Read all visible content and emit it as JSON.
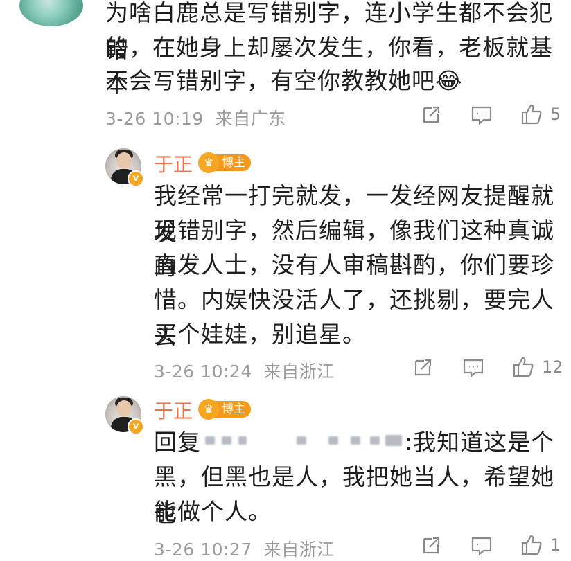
{
  "comment": {
    "lines": [
      "为啥白鹿总是写错别字，连小学生都不会犯错",
      "的，在她身上却屡次发生，你看，老板就基本",
      "不会写错别字，有空你教教她吧"
    ],
    "emoji": "😂",
    "time": "3-26 10:19",
    "location": "来自广东",
    "likes": "5"
  },
  "replies": [
    {
      "username": "于正",
      "badge": "博主",
      "lines": [
        "我经常一打完就发，一发经网友提醒就发",
        "现错别字，然后编辑，像我们这种真诚的",
        "直发人士，没有人审稿斟酌，你们要珍",
        "惜。内娱快没活人了，还挑剔，要完人去",
        "买个娃娃，别追星。"
      ],
      "time": "3-26 10:24",
      "location": "来自浙江",
      "likes": "12"
    },
    {
      "username": "于正",
      "badge": "博主",
      "reply_prefix": "回复",
      "lines_after_prefix": ":我知道这是个",
      "lines": [
        "黑，但黑也是人，我把她当人，希望她也",
        "能做个人。"
      ],
      "time": "3-26 10:27",
      "location": "来自浙江",
      "likes": "1"
    }
  ],
  "icons": {
    "share": "share-icon",
    "comment": "comment-icon",
    "like": "thumbs-up-icon",
    "verified": "verified-icon",
    "crown": "crown-icon"
  },
  "colors": {
    "username": "#eb7350",
    "badge": "#f39a1e",
    "meta": "#9b9b9b"
  }
}
